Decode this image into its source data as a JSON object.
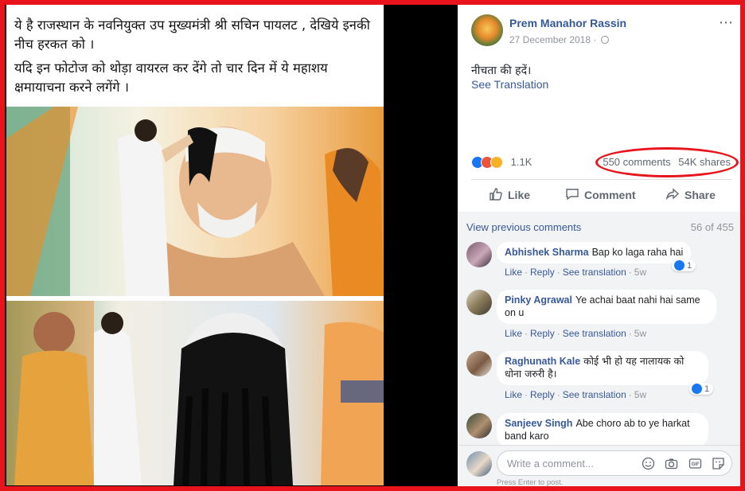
{
  "left_image": {
    "caption_line1": "ये है राजस्थान के नवनियुक्त उप मुख्यमंत्री श्री सचिन पायलट , देखिये इनकी नीच हरकत को ।",
    "caption_line2": "यदि इन फोटोज को थोड़ा वायरल कर देंगे तो चार दिन में ये महाशय क्षमायाचना करने लगेंगे ।"
  },
  "post": {
    "author": "Prem Manahor Rassin",
    "date": "27 December 2018 · ",
    "more_icon": "⋯",
    "text": "नीचता की हदें।",
    "see_translation": "See Translation",
    "reaction_count": "1.1K",
    "comments_count": "550 comments",
    "shares_count": "54K shares",
    "highlight_color": "#e8131b"
  },
  "actions": {
    "like": "Like",
    "comment": "Comment",
    "share": "Share"
  },
  "comments_section": {
    "view_previous": "View previous comments",
    "count": "56 of 455",
    "items": [
      {
        "name": "Abhishek Sharma",
        "text": "Bap ko laga raha hai",
        "like": "Like",
        "reply": "Reply",
        "see_translation": "See translation",
        "time": "5w",
        "likes": "1"
      },
      {
        "name": "Pinky Agrawal",
        "text": "Ye achai baat nahi hai same on u",
        "like": "Like",
        "reply": "Reply",
        "see_translation": "See translation",
        "time": "5w",
        "likes": ""
      },
      {
        "name": "Raghunath Kale",
        "text": "कोई भी हो यह नालायक को धोना जरुरी है।",
        "like": "Like",
        "reply": "Reply",
        "see_translation": "See translation",
        "time": "5w",
        "likes": "1"
      },
      {
        "name": "Sanjeev Singh",
        "text": "Abe choro ab to ye harkat band karo"
      }
    ]
  },
  "write_comment": {
    "placeholder": "Write a comment...",
    "press_enter": "Press Enter to post."
  },
  "colors": {
    "link": "#385898",
    "like_blue": "#1877f2",
    "frame_red": "#e8131b"
  }
}
